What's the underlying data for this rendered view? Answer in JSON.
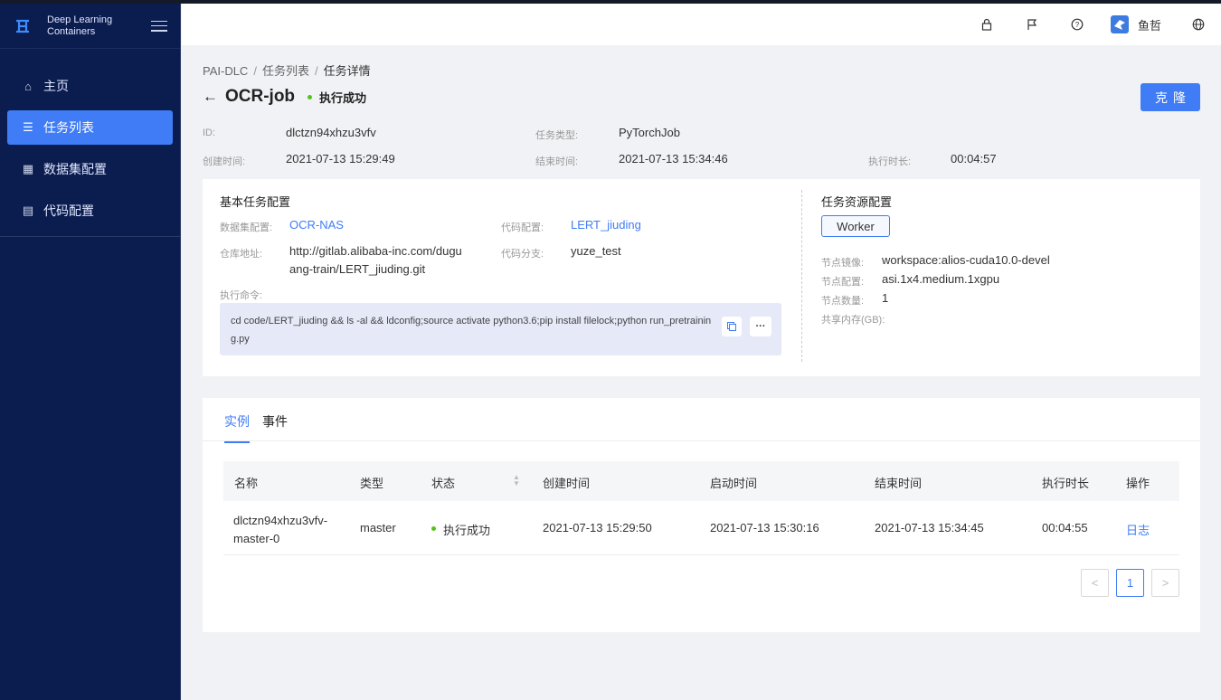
{
  "app": {
    "brand_line1": "Deep Learning",
    "brand_line2": "Containers",
    "accent_color": "#3f7cf6",
    "sidebar_bg": "#0b1c4e"
  },
  "sidebar": {
    "items": [
      {
        "label": "主页",
        "icon": "home-icon"
      },
      {
        "label": "任务列表",
        "icon": "list-icon",
        "active": true
      },
      {
        "label": "数据集配置",
        "icon": "table-icon"
      },
      {
        "label": "代码配置",
        "icon": "document-icon"
      }
    ]
  },
  "header": {
    "icons": [
      "lock-icon",
      "flag-icon",
      "help-icon",
      "globe-icon"
    ],
    "user_name": "鱼哲"
  },
  "breadcrumb": {
    "items": [
      "PAI-DLC",
      "任务列表",
      "任务详情"
    ]
  },
  "job": {
    "title": "OCR-job",
    "status": "执行成功",
    "status_color": "#52c41a",
    "clone_label": "克隆"
  },
  "meta": {
    "id_label": "ID:",
    "id_value": "dlctzn94xhzu3vfv",
    "type_label": "任务类型:",
    "type_value": "PyTorchJob",
    "created_label": "创建时间:",
    "created_value": "2021-07-13 15:29:49",
    "ended_label": "结束时间:",
    "ended_value": "2021-07-13 15:34:46",
    "duration_label": "执行时长:",
    "duration_value": "00:04:57"
  },
  "basic_config": {
    "title": "基本任务配置",
    "dataset_label": "数据集配置:",
    "dataset_value": "OCR-NAS",
    "code_label": "代码配置:",
    "code_value": "LERT_jiuding",
    "repo_label": "仓库地址:",
    "repo_value_line1": "http://gitlab.alibaba-inc.com/dugu",
    "repo_value_line2": "ang-train/LERT_jiuding.git",
    "branch_label": "代码分支:",
    "branch_value": "yuze_test",
    "command_label": "执行命令:",
    "command_value": "cd code/LERT_jiuding && ls -al && ldconfig;source activate python3.6;pip install filelock;python run_pretraining.py"
  },
  "resource_config": {
    "title": "任务资源配置",
    "tab_label": "Worker",
    "image_label": "节点镜像:",
    "image_value": "workspace:alios-cuda10.0-devel",
    "spec_label": "节点配置:",
    "spec_value": "asi.1x4.medium.1xgpu",
    "count_label": "节点数量:",
    "count_value": "1",
    "shm_label": "共享内存(GB):"
  },
  "instances": {
    "tabs": [
      "实例",
      "事件"
    ],
    "columns": [
      "名称",
      "类型",
      "状态",
      "创建时间",
      "启动时间",
      "结束时间",
      "执行时长",
      "操作"
    ],
    "rows": [
      {
        "name": "dlctzn94xhzu3vfv-master-0",
        "type": "master",
        "status": "执行成功",
        "created": "2021-07-13 15:29:50",
        "started": "2021-07-13 15:30:16",
        "ended": "2021-07-13 15:34:45",
        "duration": "00:04:55",
        "action": "日志"
      }
    ],
    "pagination": {
      "prev": "<",
      "current": "1",
      "next": ">"
    }
  }
}
